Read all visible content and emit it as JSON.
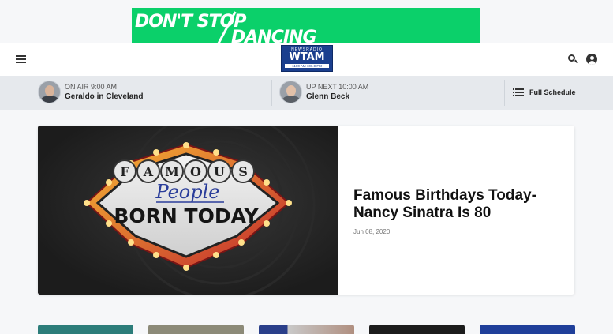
{
  "ad": {
    "line1": "DON'T STOP",
    "line2": "DANCING",
    "bg_color": "#0bd06a"
  },
  "header": {
    "logo": {
      "top_text": "NEWSRADIO",
      "main_text": "WTAM",
      "frequencies": "1100 AM   106.9 FM"
    },
    "menu_icon": "hamburger-icon",
    "search_icon": "search-icon",
    "account_icon": "user-icon"
  },
  "schedule": {
    "on_air": {
      "status": "ON AIR",
      "time": "9:00 AM",
      "show": "Geraldo in Cleveland"
    },
    "up_next": {
      "status": "UP NEXT",
      "time": "10:00 AM",
      "show": "Glenn Beck"
    },
    "full_schedule_label": "Full Schedule"
  },
  "featured": {
    "image": {
      "line1": "FAMOUS",
      "line2": "People",
      "line3": "BORN TODAY"
    },
    "title": "Famous Birthdays Today- Nancy Sinatra Is 80",
    "date": "Jun 08, 2020"
  },
  "colors": {
    "brand_blue": "#1b3f8e",
    "page_bg": "#f6f7f9",
    "schedule_bg": "#e6e9ed"
  }
}
